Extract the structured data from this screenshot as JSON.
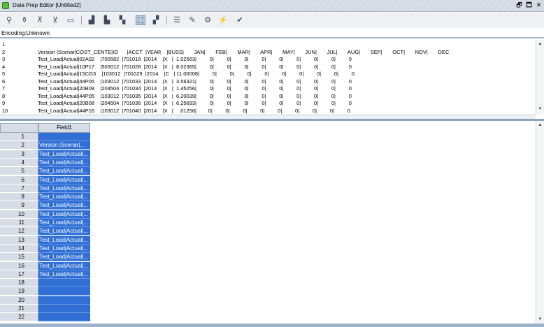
{
  "window": {
    "title": "Data Prep Editor [Untitled2]",
    "restore_glyph": "🗗",
    "maximize_glyph": "🗖",
    "close_glyph": "✕"
  },
  "toolbar": {
    "buttons": [
      {
        "icon": "field-properties-icon",
        "glyph": "⚲"
      },
      {
        "icon": "field-move-icon",
        "glyph": "⚱"
      },
      {
        "icon": "join-fields-icon",
        "glyph": "⊼"
      },
      {
        "icon": "split-fields-icon",
        "glyph": "⊻"
      },
      {
        "icon": "create-field-icon",
        "glyph": "▭"
      },
      {
        "icon": "select-record-icon",
        "glyph": "▟"
      },
      {
        "icon": "reject-record-icon",
        "glyph": "▙"
      },
      {
        "icon": "delete-record-icon",
        "glyph": "▚"
      },
      {
        "icon": "ignore-field-icon",
        "glyph": "⛶"
      },
      {
        "icon": "dimension-build-icon",
        "glyph": "▞"
      },
      {
        "icon": "data-load-settings-icon",
        "glyph": "☰"
      },
      {
        "icon": "edit-icon",
        "glyph": "✎"
      },
      {
        "icon": "find-icon",
        "glyph": "⚙"
      },
      {
        "icon": "associate-outline-icon",
        "glyph": "⚡"
      },
      {
        "icon": "validate-icon",
        "glyph": "✔"
      }
    ]
  },
  "encoding_label": "Encoding:Unknown",
  "raw_lines": [
    {
      "num": "1",
      "text": ""
    },
    {
      "num": "2",
      "text": "Version |Scenar|COST_CENTE|IO      |ACCT  |YEAR    |BUSS|       JAN|       FEB|       MAR|       APR|       MAY|       JUN|       JUL|       AUG|       SEP|       OCT|       NOV|       DEC"
    },
    {
      "num": "3",
      "text": "Test_Load|Actual|02A02    |700582  |701016  |2014    |X   |  1.02563|         0|         0|         0|         0|         0|         0|         0|         0|         0"
    },
    {
      "num": "4",
      "text": "Test_Load|Actual|10P17    |503012  |701028  |2014    |X   |  8.02365|         0|         0|         0|         0|         0|         0|         0|         0|         0"
    },
    {
      "num": "5",
      "text": "Test_Load|Actual|15CG3    |103012  |701029  |2014    |C   | 11.00008|         0|         0|         0|         0|         0|         0|         0|         0|         0"
    },
    {
      "num": "6",
      "text": "Test_Load|Actual|44P05    |103012  |701033  |2014    |X   |  3.56321|         0|         0|         0|         0|         0|         0|         0|         0|         0"
    },
    {
      "num": "7",
      "text": "Test_Load|Actual|20B08    |204504  |701034  |2014    |X   |  1.45256|         0|         0|         0|         0|         0|         0|         0|         0|         0"
    },
    {
      "num": "8",
      "text": "Test_Load|Actual|44P05    |103012  |701035  |2014    |X   |  6.20039|         0|         0|         0|         0|         0|         0|         0|         0|         0"
    },
    {
      "num": "9",
      "text": "Test_Load|Actual|20B08    |204504  |701036  |2014    |X   |  6.25693|         0|         0|         0|         0|         0|         0|         0|         0|         0"
    },
    {
      "num": "10",
      "text": "Test_Load|Actual|44P16    |103012  |701040  |2014    |X   |    .01256|        0|         0|         0|         0|         0|         0|         0|         0|         0"
    }
  ],
  "grid": {
    "column_header": "Field1",
    "rows": [
      {
        "num": "1",
        "value": ""
      },
      {
        "num": "2",
        "value": "Version |Scenar|..."
      },
      {
        "num": "3",
        "value": "Test_Load|Actual|..."
      },
      {
        "num": "4",
        "value": "Test_Load|Actual|..."
      },
      {
        "num": "5",
        "value": "Test_Load|Actual|..."
      },
      {
        "num": "6",
        "value": "Test_Load|Actual|..."
      },
      {
        "num": "7",
        "value": "Test_Load|Actual|..."
      },
      {
        "num": "8",
        "value": "Test_Load|Actual|..."
      },
      {
        "num": "9",
        "value": "Test_Load|Actual|..."
      },
      {
        "num": "10",
        "value": "Test_Load|Actual|..."
      },
      {
        "num": "11",
        "value": "Test_Load|Actual|..."
      },
      {
        "num": "12",
        "value": "Test_Load|Actual|..."
      },
      {
        "num": "13",
        "value": "Test_Load|Actual|..."
      },
      {
        "num": "14",
        "value": "Test_Load|Actual|..."
      },
      {
        "num": "15",
        "value": "Test_Load|Actual|..."
      },
      {
        "num": "16",
        "value": "Test_Load|Actual|..."
      },
      {
        "num": "17",
        "value": "Test_Load|Actual|..."
      },
      {
        "num": "18",
        "value": ""
      },
      {
        "num": "19",
        "value": ""
      },
      {
        "num": "20",
        "value": ""
      },
      {
        "num": "21",
        "value": ""
      },
      {
        "num": "22",
        "value": ""
      }
    ]
  },
  "scroll": {
    "up": "▲",
    "down": "▼"
  }
}
